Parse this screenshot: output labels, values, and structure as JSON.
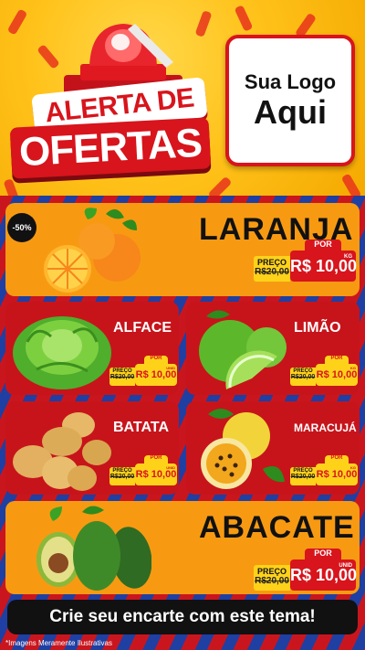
{
  "header": {
    "alert_line1": "ALERTA DE",
    "alert_line2": "OFERTAS",
    "logo_line1": "Sua Logo",
    "logo_line2": "Aqui"
  },
  "badge": {
    "discount": "-50%"
  },
  "products": {
    "laranja": {
      "name": "LARANJA",
      "preco_label": "PREÇO",
      "old_price": "R$20,00",
      "por_label": "POR",
      "new_price": "R$ 10,00",
      "unit": "KG"
    },
    "alface": {
      "name": "ALFACE",
      "preco_label": "PREÇO",
      "old_price": "R$20,00",
      "por_label": "POR",
      "new_price": "R$ 10,00",
      "unit": "UNID"
    },
    "limao": {
      "name": "LIMÃO",
      "preco_label": "PREÇO",
      "old_price": "R$20,00",
      "por_label": "POR",
      "new_price": "R$ 10,00",
      "unit": "KG"
    },
    "batata": {
      "name": "BATATA",
      "preco_label": "PREÇO",
      "old_price": "R$20,00",
      "por_label": "POR",
      "new_price": "R$ 10,00",
      "unit": "UNID"
    },
    "maracuja": {
      "name": "MARACUJÁ",
      "preco_label": "PREÇO",
      "old_price": "R$20,00",
      "por_label": "POR",
      "new_price": "R$ 10,00",
      "unit": "KG"
    },
    "abacate": {
      "name": "ABACATE",
      "preco_label": "PREÇO",
      "old_price": "R$20,00",
      "por_label": "POR",
      "new_price": "R$ 10,00",
      "unit": "UNID"
    }
  },
  "footer": {
    "cta": "Crie seu encarte com este tema!",
    "disclaimer": "*Imagens Meramente Ilustrativas"
  },
  "colors": {
    "accent_red": "#d8141c",
    "accent_orange": "#f79a12",
    "accent_yellow": "#ffd21a",
    "blue_stripe": "#1f3fa3"
  }
}
